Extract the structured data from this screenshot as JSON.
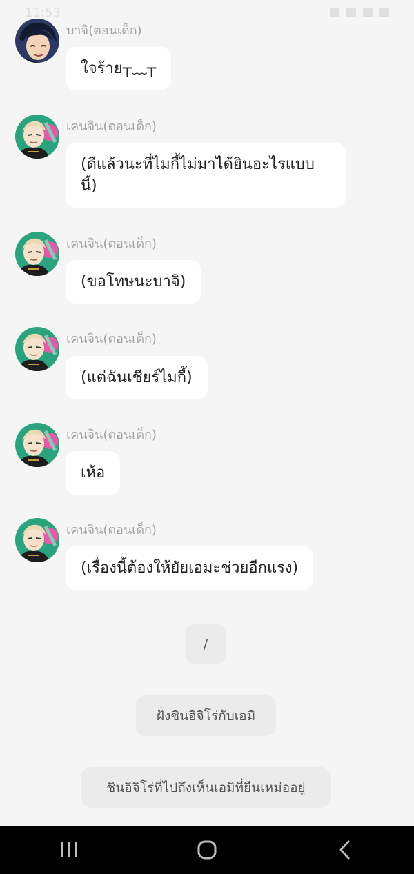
{
  "status_bar": {
    "time": "11:53"
  },
  "messages": [
    {
      "sender": "บาจิ(ตอนเด็ก)",
      "text": "ใจร้าย┬﹏┬",
      "avatar": "baji"
    },
    {
      "sender": "เคนจิน(ตอนเด็ก)",
      "text": "(ดีแล้วนะที่ไมกี้ไม่มาได้ยินอะไรแบบนี้)",
      "avatar": "kenjin"
    },
    {
      "sender": "เคนจิน(ตอนเด็ก)",
      "text": "(ขอโทษนะบาจิ)",
      "avatar": "kenjin"
    },
    {
      "sender": "เคนจิน(ตอนเด็ก)",
      "text": "(แต่ฉันเชียร์ไมกี้)",
      "avatar": "kenjin"
    },
    {
      "sender": "เคนจิน(ตอนเด็ก)",
      "text": "เห้อ",
      "avatar": "kenjin"
    },
    {
      "sender": "เคนจิน(ตอนเด็ก)",
      "text": "(เรื่องนี้ต้องให้ยัยเอมะช่วยอีกแรง)",
      "avatar": "kenjin"
    }
  ],
  "choices": [
    {
      "label": "/"
    },
    {
      "label": "ฝั่งชินอิจิโร่กับเอมิ"
    },
    {
      "label": "ชินอิจิโร่ที่ไปถึงเห็นเอมิที่ยืนเหม่ออยู่"
    }
  ],
  "nav": {
    "recent": "recent-apps-icon",
    "home": "home-icon",
    "back": "back-icon"
  },
  "colors": {
    "background": "#f5f5f5",
    "bubble": "#ffffff",
    "choice": "#ebebeb",
    "sender": "#a3a3a3",
    "nav_bar": "#000000"
  }
}
